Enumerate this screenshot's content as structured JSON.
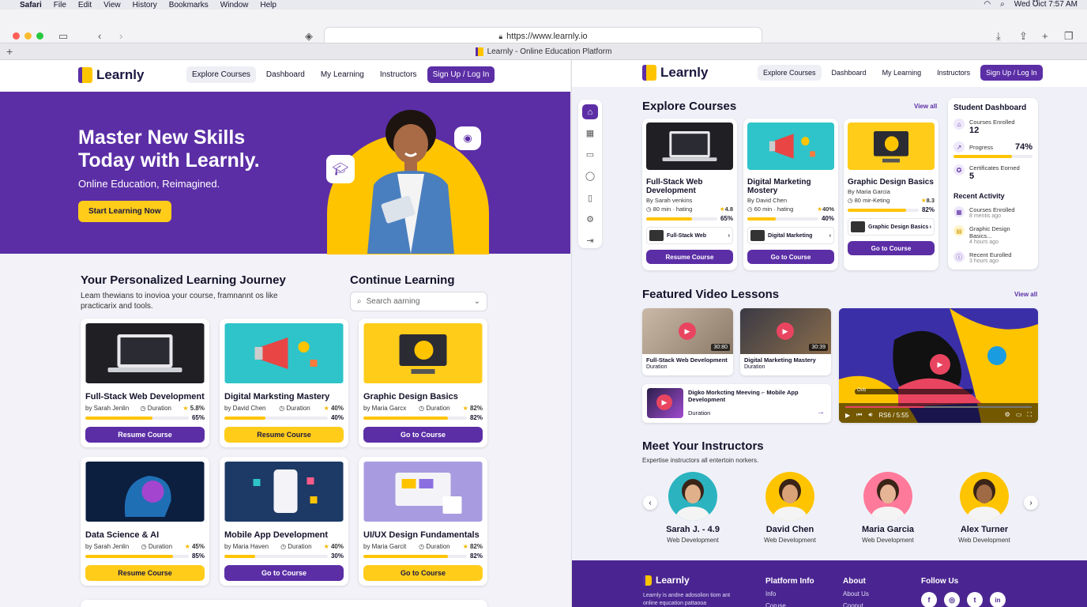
{
  "menubar": {
    "app": "Safari",
    "items": [
      "File",
      "Edit",
      "View",
      "History",
      "Bookmarks",
      "Window",
      "Help"
    ],
    "clock": "Wed ℧ict 7:57 AM"
  },
  "browser": {
    "url": "https://www.learnly.io",
    "tab_title": "Learnly - Online Education Platform"
  },
  "brand": {
    "name": "Learnly",
    "primary": "#5b2ea6",
    "accent": "#ffc400"
  },
  "nav": {
    "links": [
      "Explore Courses",
      "Dashboard",
      "My Learning",
      "Instructors"
    ],
    "cta": "Sign Up / Log In"
  },
  "hero": {
    "title": "Master New Skills Today with Learnly.",
    "subtitle": "Online Education, Reimagined.",
    "button": "Start Learning Now"
  },
  "journey": {
    "title": "Your Personalized Learning Journey",
    "desc": "Leam thewians to inovioa your course, framnannt os like practicarix and tools."
  },
  "continue": {
    "title": "Continue Learning",
    "search_placeholder": "Search aarning"
  },
  "courses": [
    {
      "title": "Full-Stack Web Development",
      "author": "by Sarah Jenlin",
      "duration": "Duration",
      "rating": "5.8%",
      "progress": 65,
      "progress_label": "65%",
      "button": "Resume Course",
      "style": "purple"
    },
    {
      "title": "Digital Marksting Mastery",
      "author": "by David Chen",
      "duration": "Duration",
      "rating": "40%",
      "progress": 40,
      "progress_label": "40%",
      "button": "Resume Course",
      "style": "yellow"
    },
    {
      "title": "Graphic Design Basics",
      "author": "by Maria Garcx",
      "duration": "Duration",
      "rating": "82%",
      "progress": 82,
      "progress_label": "82%",
      "button": "Go to Course",
      "style": "purple"
    },
    {
      "title": "Data Science & AI",
      "author": "by Sarah Jenlin",
      "duration": "Duration",
      "rating": "45%",
      "progress": 85,
      "progress_label": "85%",
      "button": "Resume Course",
      "style": "yellow"
    },
    {
      "title": "Mobile App Development",
      "author": "by Maria Haven",
      "duration": "Duration",
      "rating": "40%",
      "progress": 30,
      "progress_label": "30%",
      "button": "Go to Course",
      "style": "purple"
    },
    {
      "title": "UI/UX Design Fundamentals",
      "author": "by Maria Garcit",
      "duration": "Duration",
      "rating": "82%",
      "progress": 82,
      "progress_label": "82%",
      "button": "Go to Course",
      "style": "yellow"
    }
  ],
  "explore": {
    "title": "Explore Courses",
    "view_all": "View all"
  },
  "explore_courses": [
    {
      "title": "Full-Stack Web Development",
      "author": "By Sarah venkins",
      "meta": "80 min · hating",
      "rating": "4.8",
      "progress": 65,
      "progress_label": "65%",
      "mini": "Full-Stack Web",
      "button": "Resume Course"
    },
    {
      "title": "Digital Marketing Mostery",
      "author": "By David Chen",
      "meta": "60 min · hating",
      "rating": "40%",
      "progress": 40,
      "progress_label": "40%",
      "mini": "Digital Marketing",
      "button": "Go to Course"
    },
    {
      "title": "Graphic Design Basics",
      "author": "By Maria Garcia",
      "meta": "80 mir-Keting",
      "rating": "8.3",
      "progress": 82,
      "progress_label": "82%",
      "mini": "Graphic Design Basics",
      "button": "Go to Course"
    }
  ],
  "dashboard": {
    "title": "Student Dashboard",
    "stats": [
      {
        "label": "Courses Enrolled",
        "value": "12"
      },
      {
        "label": "Progress",
        "value": "74%",
        "bar": 74
      },
      {
        "label": "Certificates Eorned",
        "value": "5"
      }
    ],
    "activity_title": "Recent Activity",
    "activity": [
      {
        "label": "Courses Enrolled",
        "time": "8 mentis ago"
      },
      {
        "label": "Graphic Design Basics...",
        "time": "4 hours ago"
      },
      {
        "label": "Recent Eurolled",
        "time": "3 hours ago"
      }
    ]
  },
  "videos": {
    "title": "Featured Video Lessons",
    "view_all": "View all",
    "items": [
      {
        "title": "Full-Stack Web Development",
        "sub": "Duration",
        "time": "30:80"
      },
      {
        "title": "Digital Marketing Mastery",
        "sub": "Duration",
        "time": "30:39"
      },
      {
        "title": "Digko Morkcting Meeving ⌐ Mobile App Development",
        "sub": "Duration"
      }
    ],
    "player": {
      "time": "RS6 / 5:55",
      "scrub_label": "Ovb"
    }
  },
  "instructors": {
    "title": "Meet Your Instructors",
    "desc": "Expertise instructors all entertoin norkers.",
    "people": [
      {
        "name": "Sarah J. - 4.9",
        "role": "Web Development"
      },
      {
        "name": "David Chen",
        "role": "Web Development"
      },
      {
        "name": "Maria Garcia",
        "role": "Web Development"
      },
      {
        "name": "Alex Turner",
        "role": "Web Development"
      }
    ]
  },
  "footer": {
    "brand_text": "Learnly is andne adosolion tiom ant online equcation pattaooa",
    "cols": [
      {
        "title": "Platform Info",
        "links": [
          "Info",
          "Coruse"
        ]
      },
      {
        "title": "About",
        "links": [
          "About Us",
          "Coonut"
        ]
      },
      {
        "title": "Follow Us",
        "links": []
      }
    ],
    "social": [
      "f",
      "◎",
      "t",
      "in"
    ]
  }
}
